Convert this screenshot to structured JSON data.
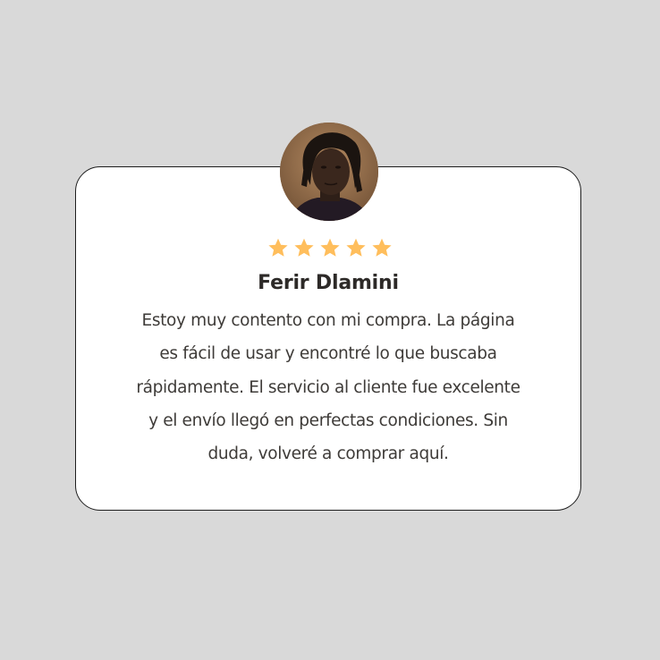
{
  "testimonial": {
    "reviewer_name": "Ferir Dlamini",
    "rating": 5,
    "rating_max": 5,
    "star_color": "#ffbe5c",
    "review_lines": [
      "Estoy muy contento con mi compra. La página",
      "es fácil de usar y encontré lo que buscaba",
      "rápidamente. El servicio al cliente fue excelente",
      "y el envío llegó en perfectas condiciones. Sin",
      "duda, volveré a comprar aquí."
    ]
  }
}
